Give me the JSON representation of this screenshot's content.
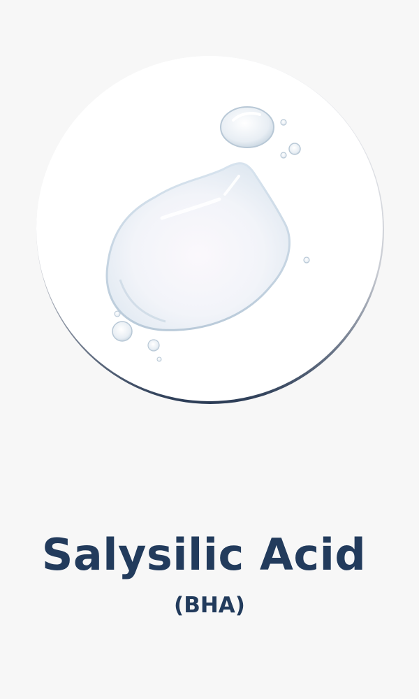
{
  "ingredient": {
    "name": "Salysilic Acid",
    "type": "(BHA)"
  },
  "image": {
    "icon": "serum-droplet-icon"
  },
  "colors": {
    "background": "#f7f7f7",
    "text": "#223b5c",
    "circle": "#ffffff",
    "rim": "#2a3b55"
  }
}
